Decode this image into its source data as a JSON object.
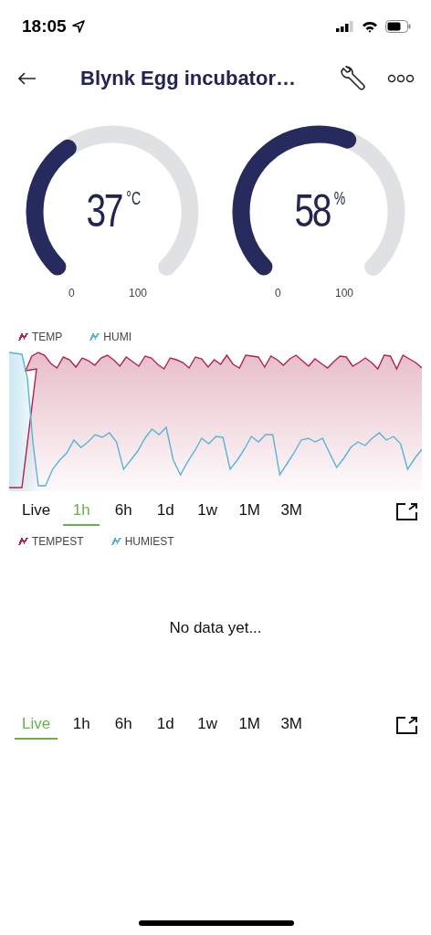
{
  "status_bar": {
    "time": "18:05"
  },
  "header": {
    "title": "Blynk Egg incubator…"
  },
  "gauges": [
    {
      "value": "37",
      "unit": "°C",
      "min": "0",
      "max": "100",
      "level": 0.37
    },
    {
      "value": "58",
      "unit": "%",
      "min": "0",
      "max": "100",
      "level": 0.58
    }
  ],
  "charts": [
    {
      "kind": "plot",
      "legend": [
        {
          "label": "TEMP",
          "color": "#b0244a"
        },
        {
          "label": "HUMI",
          "color": "#56b4d8"
        }
      ],
      "ranges": [
        {
          "label": "Live",
          "selected": false
        },
        {
          "label": "1h",
          "selected": true
        },
        {
          "label": "6h",
          "selected": false
        },
        {
          "label": "1d",
          "selected": false
        },
        {
          "label": "1w",
          "selected": false
        },
        {
          "label": "1M",
          "selected": false
        },
        {
          "label": "3M",
          "selected": false
        }
      ]
    },
    {
      "kind": "empty",
      "message": "No data yet...",
      "legend": [
        {
          "label": "TEMPEST",
          "color": "#b0244a"
        },
        {
          "label": "HUMIEST",
          "color": "#56b4d8"
        }
      ],
      "ranges": [
        {
          "label": "Live",
          "selected": true
        },
        {
          "label": "1h",
          "selected": false
        },
        {
          "label": "6h",
          "selected": false
        },
        {
          "label": "1d",
          "selected": false
        },
        {
          "label": "1w",
          "selected": false
        },
        {
          "label": "1M",
          "selected": false
        },
        {
          "label": "3M",
          "selected": false
        }
      ]
    }
  ]
}
